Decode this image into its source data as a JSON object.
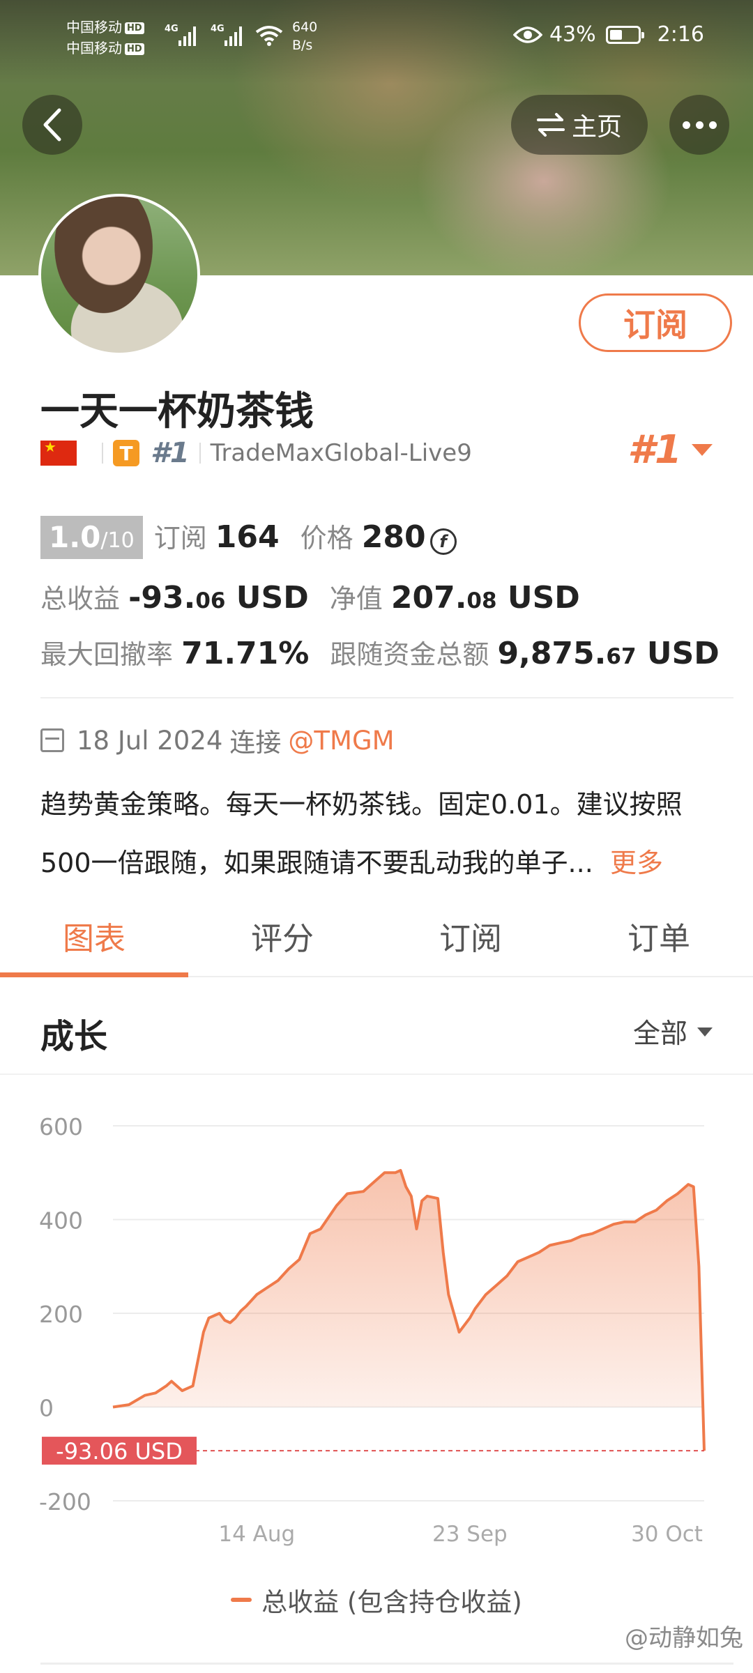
{
  "status_bar": {
    "carrier_1": "中国移动",
    "carrier_2": "中国移动",
    "hd": "HD",
    "net_type": "4G",
    "net_speed": "640",
    "net_unit": "B/s",
    "battery": "43%",
    "time": "2:16"
  },
  "nav": {
    "home_label": "主页"
  },
  "profile": {
    "subscribe_label": "订阅",
    "name": "一天一杯奶茶钱",
    "badge_letter": "T",
    "rank_small": "#1",
    "server": "TradeMaxGlobal-Live9",
    "rank_big": "#1"
  },
  "stats": {
    "score": "1.0",
    "score_max": "/10",
    "subscribers_label": "订阅",
    "subscribers_value": "164",
    "price_label": "价格",
    "price_value": "280",
    "coin_symbol": "f",
    "total_pl_label": "总收益",
    "total_pl_int": "-93.",
    "total_pl_dec": "06",
    "total_pl_unit": " USD",
    "equity_label": "净值",
    "equity_int": "207.",
    "equity_dec": "08",
    "equity_unit": " USD",
    "max_dd_label": "最大回撤率",
    "max_dd_value": "71.71%",
    "follow_funds_label": "跟随资金总额",
    "follow_funds_int": "9,875.",
    "follow_funds_dec": "67",
    "follow_funds_unit": " USD"
  },
  "info": {
    "date": "18 Jul 2024",
    "connect_label": "连接",
    "broker": "@TMGM",
    "description_line1": "趋势黄金策略。每天一杯奶茶钱。固定0.01。建议按照",
    "description_line2": "500一倍跟随，如果跟随请不要乱动我的单子...",
    "more_label": "更多"
  },
  "tabs": [
    {
      "label": "图表",
      "active": true
    },
    {
      "label": "评分",
      "active": false
    },
    {
      "label": "订阅",
      "active": false
    },
    {
      "label": "订单",
      "active": false
    }
  ],
  "section": {
    "title": "成长",
    "range_label": "全部"
  },
  "chart_data": {
    "type": "area",
    "title": "成长",
    "y_ticks": [
      "600",
      "400",
      "200",
      "0",
      "-200"
    ],
    "ylim": [
      -200,
      600
    ],
    "x_ticks": [
      "14 Aug",
      "23 Sep",
      "30 Oct"
    ],
    "x_tick_values": [
      27,
      67,
      104
    ],
    "xlim": [
      0,
      111
    ],
    "current_value_label": "-93.06 USD",
    "current_value": -93.06,
    "accent_color": "#ef7a4a",
    "series": [
      {
        "name": "总收益 (包含持仓收益)",
        "x": [
          0,
          3,
          6,
          8,
          10,
          11,
          13,
          14,
          15,
          17,
          18,
          20,
          21,
          22,
          23,
          24,
          25,
          27,
          29,
          31,
          33,
          35,
          37,
          39,
          42,
          44,
          47,
          49,
          51,
          52,
          53,
          54,
          55,
          56,
          57,
          58,
          59,
          61,
          62,
          63,
          65,
          67,
          68,
          70,
          72,
          74,
          76,
          78,
          80,
          82,
          84,
          86,
          88,
          90,
          92,
          94,
          96,
          98,
          100,
          102,
          104,
          106,
          108,
          109,
          110,
          111
        ],
        "y": [
          0,
          5,
          25,
          30,
          45,
          55,
          35,
          40,
          45,
          160,
          190,
          200,
          185,
          180,
          190,
          205,
          215,
          240,
          255,
          270,
          295,
          315,
          370,
          380,
          430,
          455,
          460,
          480,
          500,
          500,
          500,
          505,
          470,
          450,
          380,
          440,
          450,
          445,
          330,
          240,
          160,
          190,
          210,
          240,
          260,
          280,
          310,
          320,
          330,
          345,
          350,
          355,
          365,
          370,
          380,
          390,
          395,
          395,
          410,
          420,
          440,
          455,
          475,
          470,
          300,
          -93.06
        ]
      }
    ]
  },
  "legend": {
    "label": "总收益 (包含持仓收益)"
  },
  "watermark": "@动静如兔"
}
